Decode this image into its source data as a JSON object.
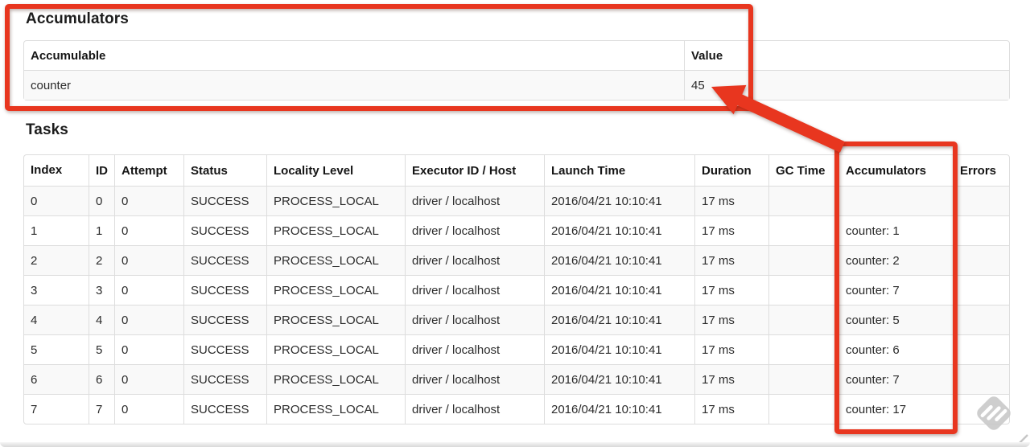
{
  "accumulators_section": {
    "title": "Accumulators",
    "table": {
      "headers": [
        "Accumulable",
        "Value"
      ],
      "rows": [
        [
          "counter",
          "45"
        ]
      ]
    }
  },
  "tasks_section": {
    "title": "Tasks",
    "table": {
      "headers": [
        "Index",
        "ID",
        "Attempt",
        "Status",
        "Locality Level",
        "Executor ID / Host",
        "Launch Time",
        "Duration",
        "GC Time",
        "Accumulators",
        "Errors"
      ],
      "sort_column": "Index",
      "sort_icon": "▲",
      "rows": [
        [
          "0",
          "0",
          "0",
          "SUCCESS",
          "PROCESS_LOCAL",
          "driver / localhost",
          "2016/04/21 10:10:41",
          "17 ms",
          "",
          "",
          ""
        ],
        [
          "1",
          "1",
          "0",
          "SUCCESS",
          "PROCESS_LOCAL",
          "driver / localhost",
          "2016/04/21 10:10:41",
          "17 ms",
          "",
          "counter: 1",
          ""
        ],
        [
          "2",
          "2",
          "0",
          "SUCCESS",
          "PROCESS_LOCAL",
          "driver / localhost",
          "2016/04/21 10:10:41",
          "17 ms",
          "",
          "counter: 2",
          ""
        ],
        [
          "3",
          "3",
          "0",
          "SUCCESS",
          "PROCESS_LOCAL",
          "driver / localhost",
          "2016/04/21 10:10:41",
          "17 ms",
          "",
          "counter: 7",
          ""
        ],
        [
          "4",
          "4",
          "0",
          "SUCCESS",
          "PROCESS_LOCAL",
          "driver / localhost",
          "2016/04/21 10:10:41",
          "17 ms",
          "",
          "counter: 5",
          ""
        ],
        [
          "5",
          "5",
          "0",
          "SUCCESS",
          "PROCESS_LOCAL",
          "driver / localhost",
          "2016/04/21 10:10:41",
          "17 ms",
          "",
          "counter: 6",
          ""
        ],
        [
          "6",
          "6",
          "0",
          "SUCCESS",
          "PROCESS_LOCAL",
          "driver / localhost",
          "2016/04/21 10:10:41",
          "17 ms",
          "",
          "counter: 7",
          ""
        ],
        [
          "7",
          "7",
          "0",
          "SUCCESS",
          "PROCESS_LOCAL",
          "driver / localhost",
          "2016/04/21 10:10:41",
          "17 ms",
          "",
          "counter: 17",
          ""
        ]
      ]
    }
  },
  "annotation": {
    "color": "#e8361f",
    "watermark_color": "#c9c9c9",
    "highlighted_value": "45",
    "highlighted_column": "Accumulators"
  }
}
